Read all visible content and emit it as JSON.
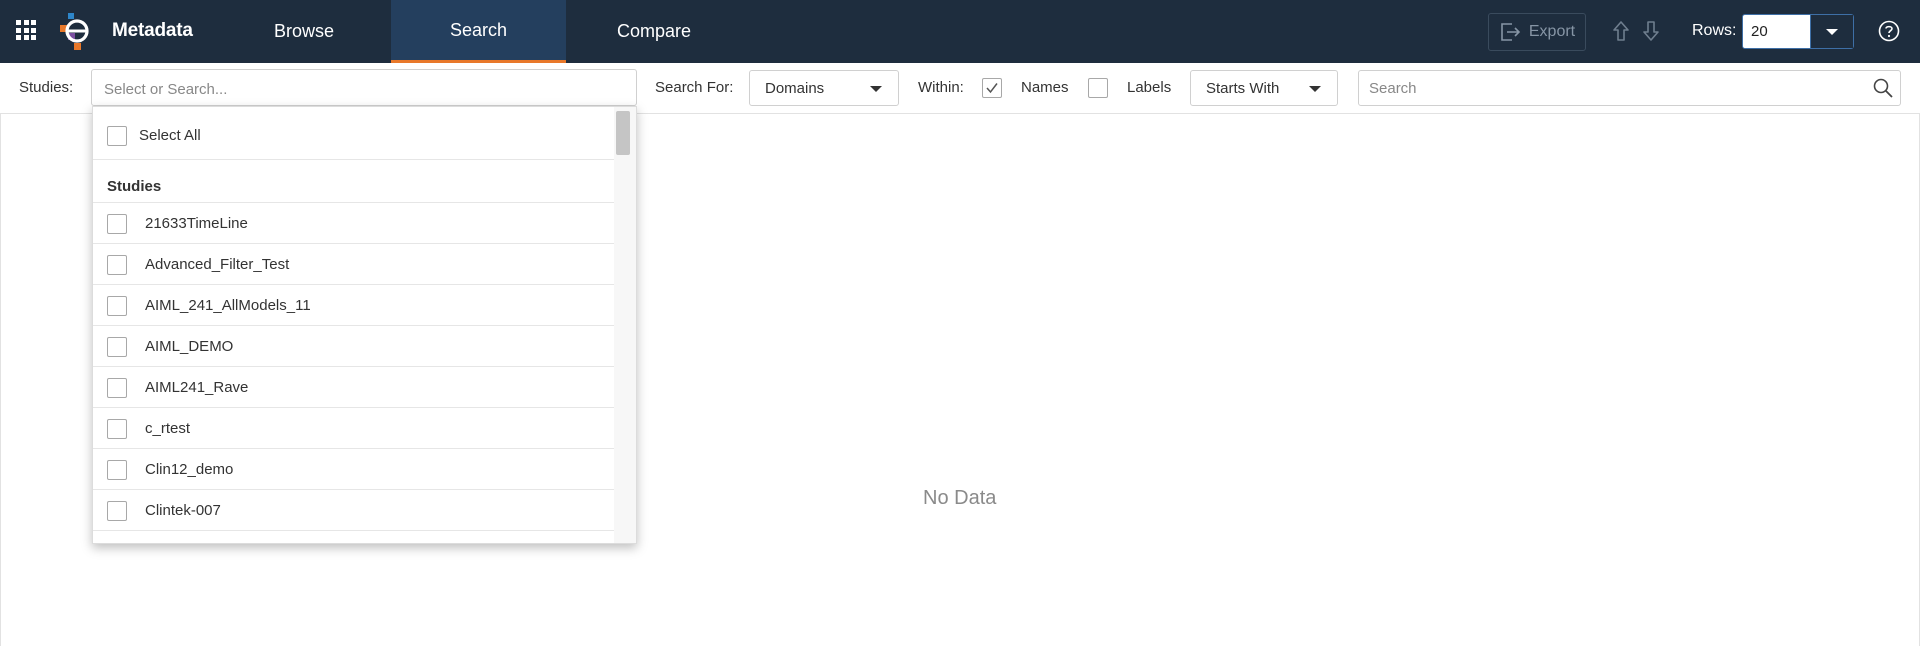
{
  "app": {
    "title": "Metadata",
    "brand_colors": {
      "navbar": "#1e2d3e",
      "active_tab": "#243f5e",
      "active_underline": "#e8782a",
      "logo_orange": "#e8782a",
      "logo_purple": "#7b4fa0",
      "logo_blue": "#2e86c9"
    }
  },
  "nav": {
    "tabs": [
      {
        "label": "Browse",
        "active": false
      },
      {
        "label": "Search",
        "active": true
      },
      {
        "label": "Compare",
        "active": false
      }
    ]
  },
  "toolbar": {
    "export_label": "Export",
    "rows_label": "Rows:",
    "rows_value": "20",
    "icons": [
      "apps-grid-icon",
      "export-icon",
      "arrow-up-icon",
      "arrow-down-icon",
      "help-icon"
    ]
  },
  "filters": {
    "studies_label": "Studies:",
    "studies_placeholder": "Select or Search...",
    "search_for_label": "Search For:",
    "search_for_value": "Domains",
    "within_label": "Within:",
    "names_label": "Names",
    "names_checked": true,
    "labels_label": "Labels",
    "labels_checked": false,
    "match_mode_value": "Starts With",
    "search_placeholder": "Search"
  },
  "studies_dropdown": {
    "select_all_label": "Select All",
    "group_header": "Studies",
    "items": [
      {
        "label": "21633TimeLine",
        "checked": false
      },
      {
        "label": "Advanced_Filter_Test",
        "checked": false
      },
      {
        "label": "AIML_241_AllModels_11",
        "checked": false
      },
      {
        "label": "AIML_DEMO",
        "checked": false
      },
      {
        "label": "AIML241_Rave",
        "checked": false
      },
      {
        "label": "c_rtest",
        "checked": false
      },
      {
        "label": "Clin12_demo",
        "checked": false
      },
      {
        "label": "Clintek-007",
        "checked": false
      }
    ]
  },
  "main": {
    "empty_text": "No Data"
  }
}
